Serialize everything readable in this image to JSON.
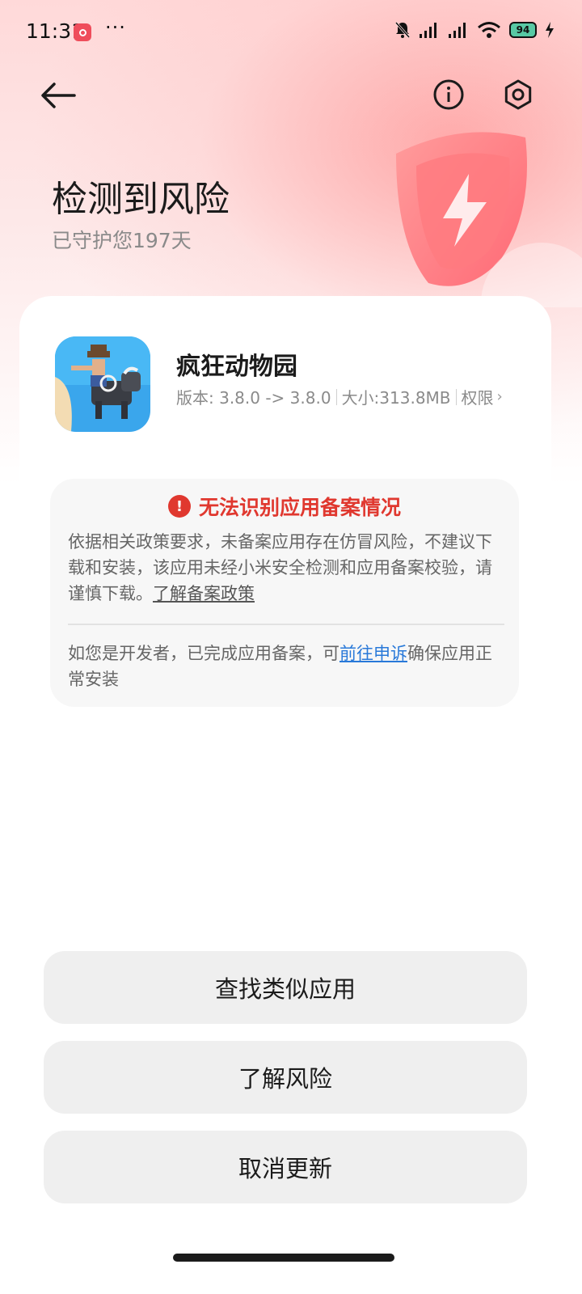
{
  "status_bar": {
    "time": "11:31",
    "more": "···",
    "battery": "94"
  },
  "header": {
    "title": "检测到风险",
    "subtitle": "已守护您197天"
  },
  "app": {
    "name": "疯狂动物园",
    "version": "版本: 3.8.0 -> 3.8.0",
    "size": "大小:313.8MB",
    "permissions": "权限"
  },
  "notice": {
    "title": "无法识别应用备案情况",
    "body": "依据相关政策要求，未备案应用存在仿冒风险，不建议下载和安装，该应用未经小米安全检测和应用备案校验，请谨慎下载。",
    "policy_link": "了解备案政策",
    "dev_prefix": "如您是开发者，已完成应用备案，可",
    "dev_link": "前往申诉",
    "dev_suffix": "确保应用正常安装"
  },
  "actions": {
    "find_similar": "查找类似应用",
    "learn_risk": "了解风险",
    "cancel_update": "取消更新"
  },
  "colors": {
    "danger": "#e0382f",
    "link": "#2979d9",
    "battery": "#58c9a4"
  }
}
